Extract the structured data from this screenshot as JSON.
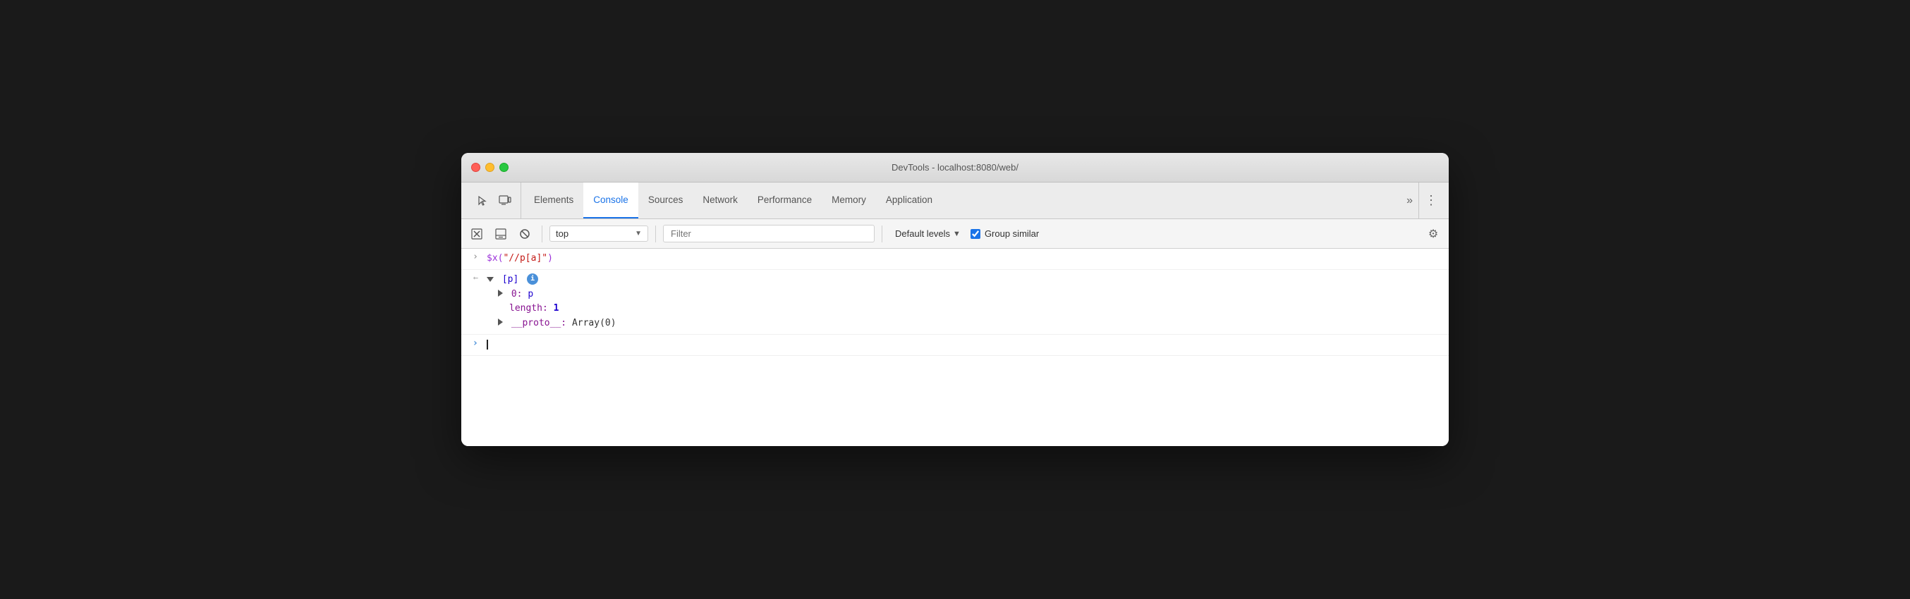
{
  "window": {
    "title": "DevTools - localhost:8080/web/"
  },
  "tabs_bar": {
    "icons": [
      {
        "name": "cursor-icon",
        "symbol": "↖"
      },
      {
        "name": "device-icon",
        "symbol": "▭"
      }
    ],
    "tabs": [
      {
        "id": "elements",
        "label": "Elements",
        "active": false
      },
      {
        "id": "console",
        "label": "Console",
        "active": true
      },
      {
        "id": "sources",
        "label": "Sources",
        "active": false
      },
      {
        "id": "network",
        "label": "Network",
        "active": false
      },
      {
        "id": "performance",
        "label": "Performance",
        "active": false
      },
      {
        "id": "memory",
        "label": "Memory",
        "active": false
      },
      {
        "id": "application",
        "label": "Application",
        "active": false
      }
    ],
    "more_label": "»",
    "kebab_label": "⋮"
  },
  "toolbar": {
    "clear_icon": "🚫",
    "filter_placeholder": "Filter",
    "context_value": "top",
    "levels_label": "Default levels",
    "group_similar_label": "Group similar",
    "group_similar_checked": true,
    "settings_icon": "⚙"
  },
  "console": {
    "rows": [
      {
        "type": "input",
        "gutter": ">",
        "content_parts": [
          {
            "text": "$x(",
            "class": "c-purple"
          },
          {
            "text": "\"//p[a]\"",
            "class": "c-string"
          },
          {
            "text": ")",
            "class": "c-purple"
          }
        ]
      },
      {
        "type": "output",
        "gutter": "←",
        "content": "array_expanded"
      },
      {
        "type": "prompt",
        "gutter": ">",
        "content": "cursor"
      }
    ],
    "array_label": "[p]",
    "item_0_label": "0:",
    "item_0_value": "p",
    "length_label": "length:",
    "length_value": "1",
    "proto_label": "__proto__:",
    "proto_value": "Array(0)"
  }
}
